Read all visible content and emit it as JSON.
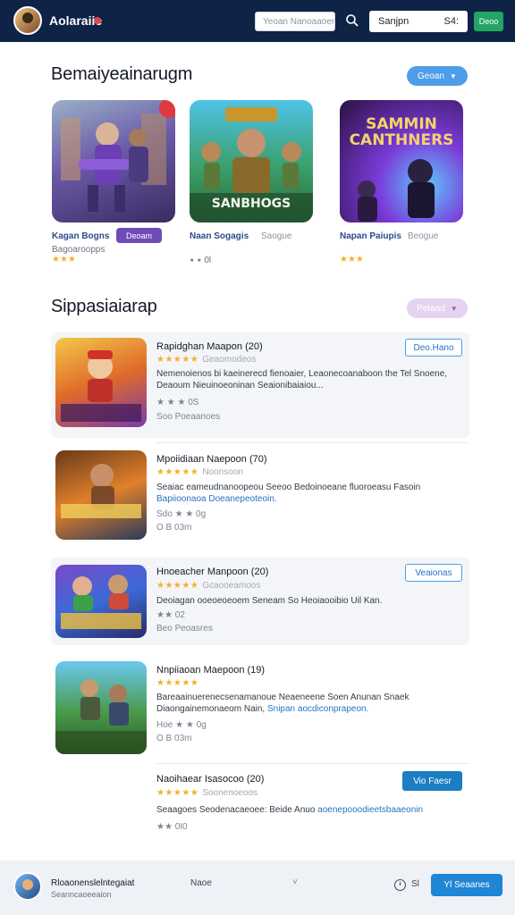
{
  "header": {
    "app_title": "Aolaraiie",
    "search_placeholder": "Yeoan Nanoaaoen",
    "signin_label": "Sanjpn",
    "signin_extra": "S4:",
    "action_label": "Deoo"
  },
  "featured": {
    "title": "Bemaiyeainarugm",
    "dropdown_label": "Geoan",
    "items": [
      {
        "name": "Kagan Bogns",
        "sub": "Bagoaroopps",
        "tag": "Deoam",
        "stars": "★★★",
        "meta": "⭑ ⭑",
        "art_text": ""
      },
      {
        "name": "Naan Sogagis",
        "sub": "Saogue",
        "tag": "",
        "stars": "",
        "meta": "⭑ ⭑ 0l",
        "art_text": "SANBHOGS"
      },
      {
        "name": "Napan Paiupis",
        "sub": "Beogue",
        "tag": "",
        "stars": "★★★",
        "meta": "",
        "art_text": "SAMMIN CANTHNERS"
      }
    ]
  },
  "popular": {
    "title": "Sippasiaiarap",
    "dropdown_label": "Petaad",
    "items": [
      {
        "title": "Rapidghan Maapon (20)",
        "rating_label": "Geaomodeos",
        "desc": "Nemenoienos bi kaeinerecd fienoaier, Leaonecoanaboon the Tel Snoene, Deaoum Nieuinoeoninan Seaionibaiaiou...",
        "desc_link": "",
        "meta": "★ ★ ★ 0S",
        "meta2": "Soo Poeaanoes",
        "button": "Deo.Hano"
      },
      {
        "title": "Mpoiidiaan Naepoon (70)",
        "rating_label": "Noonsoon",
        "desc": "Seaiac eameudnanoopeou Seeoo Bedoinoeane fluoroeasu Fasoin",
        "desc_link": "Bapiioonaoa Doeanepeoteoin.",
        "meta": "Sdo ★ ★ 0g",
        "meta2": "O B 03m",
        "button": ""
      },
      {
        "title": "Hnoeacher Manpoon (20)",
        "rating_label": "Gcaooeamoos",
        "desc": "Deoiagan ooeoeoeoem Seneam So Heoiaooibio Uil Kan.",
        "desc_link": "",
        "meta": "★★ 02",
        "meta2": "Beo Peoasres",
        "button": "Veaionas"
      },
      {
        "title": "Nnpiiaoan Maepoon (19)",
        "rating_label": "",
        "desc": "Bareaainuerenecsenamanoue Neaeneene Soen Anunan Snaek Diaongainemonaeom Nain,",
        "desc_link": "Snipan aocdiconprapeon.",
        "meta": "Hoe ★ ★ 0g",
        "meta2": "O B 03m",
        "button": ""
      },
      {
        "title": "Naoihaear Isasocoo (20)",
        "rating_label": "Soonenoeoos",
        "desc": "Seaagoes Seodenacaeoee: Beide Anuo",
        "desc_link": "aoenepooodieetsbaaeonin",
        "meta": "★★ 0I0",
        "meta2": "",
        "button": "Vio Faesr"
      }
    ]
  },
  "footer": {
    "title": "Rloaonenslelntegaiat",
    "subtitle": "Seanncaoeeaion",
    "mid_label": "Naoe",
    "count": "Sl",
    "button": "Yl Seaanes"
  },
  "colors": {
    "header_bg": "#0f2347",
    "accent_blue": "#1f86d6",
    "accent_green": "#22a565",
    "tag_purple": "#6f4bb8",
    "star": "#f0b323"
  }
}
